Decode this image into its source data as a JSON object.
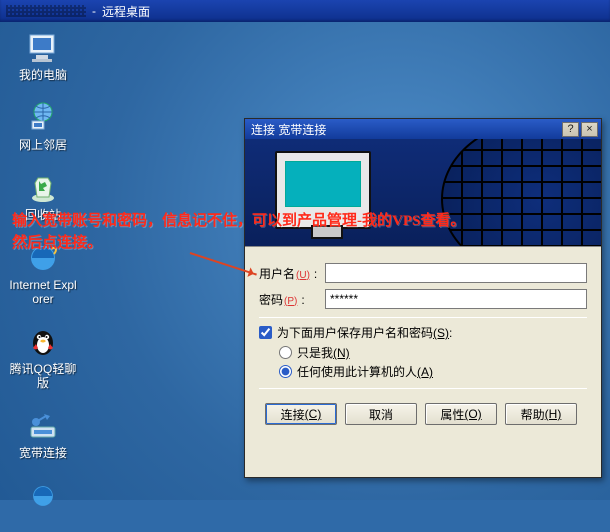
{
  "titlebar": {
    "suffix": "远程桌面",
    "sep": " - "
  },
  "desktop_icons": [
    {
      "id": "my-computer",
      "label": "我的电脑"
    },
    {
      "id": "network",
      "label": "网上邻居"
    },
    {
      "id": "recycle",
      "label": "回收站"
    },
    {
      "id": "ie",
      "label": "Internet Explorer"
    },
    {
      "id": "qq",
      "label": "腾讯QQ轻聊版"
    },
    {
      "id": "dialup",
      "label": "宽带连接"
    },
    {
      "id": "ie2",
      "label": ""
    }
  ],
  "annotation": {
    "line1": "输入宽带账号和密码，信息记不住，可以到产品管理-我的VPS查看。",
    "line2": "然后点连接。"
  },
  "dialog": {
    "title": "连接 宽带连接",
    "help_label": "?",
    "close_label": "×",
    "username_label": "用户名",
    "username_key": "(U)",
    "username_value": "",
    "password_label": "密码",
    "password_key": "(P)",
    "password_value": "******",
    "save_label": "为下面用户保存用户名和密码",
    "save_key": "(S)",
    "save_checked": true,
    "opt_only_me": "只是我",
    "opt_only_me_key": "(N)",
    "opt_anyone": "任何使用此计算机的人",
    "opt_anyone_key": "(A)",
    "selected_option": "anyone",
    "buttons": {
      "connect": "连接",
      "connect_key": "(C)",
      "cancel": "取消",
      "props": "属性",
      "props_key": "(O)",
      "help": "帮助",
      "help_key": "(H)"
    }
  }
}
